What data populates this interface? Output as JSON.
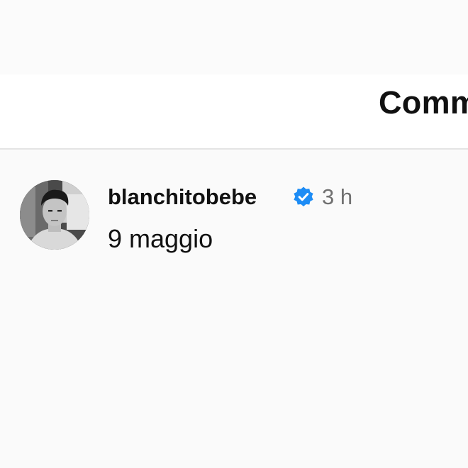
{
  "header": {
    "title": "Comm"
  },
  "comment": {
    "username": "blanchitobebe",
    "verified_icon": "verified-badge-icon",
    "timestamp": "3 h",
    "text": "9 maggio",
    "avatar_icon": "user-avatar-photo"
  },
  "colors": {
    "background": "#fafafa",
    "header_background": "#ffffff",
    "divider": "#e4e4e4",
    "text_primary": "#111111",
    "text_secondary": "#707070",
    "verified_blue": "#1d8cf5"
  }
}
